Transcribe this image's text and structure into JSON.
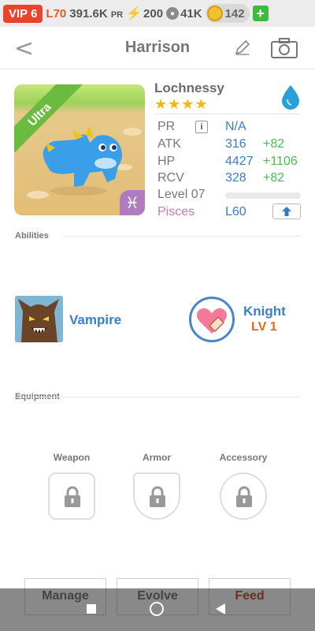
{
  "status_bar": {
    "vip": "VIP 6",
    "level": "L70",
    "power": "391.6K",
    "power_unit": "PR",
    "energy": "200",
    "food": "41K",
    "coins": "142",
    "add": "+"
  },
  "header": {
    "back_icon": "chevron-left-icon",
    "title": "Harrison",
    "edit_icon": "pencil-icon",
    "camera_icon": "camera-icon"
  },
  "pet": {
    "rarity": "Ultra",
    "zodiac_symbol": "♓",
    "name": "Lochnessy",
    "stars": "★★★★",
    "star_count": 4,
    "element_icon": "water-drop-icon",
    "colors": {
      "element": "#2aa0d8",
      "rarity": "#6abb3f",
      "zodiac": "#b07bbf"
    }
  },
  "stats": {
    "pr_label": "PR",
    "pr_info": "i",
    "pr_value": "N/A",
    "atk_label": "ATK",
    "atk_value": "316",
    "atk_bonus": "+82",
    "hp_label": "HP",
    "hp_value": "4427",
    "hp_bonus": "+1106",
    "rcv_label": "RCV",
    "rcv_value": "328",
    "rcv_bonus": "+82",
    "level_label": "Level 07",
    "level_progress": 0,
    "zodiac_label": "Pisces",
    "max_level": "L60",
    "upgrade_icon": "arrow-up-icon"
  },
  "abilities": {
    "section_label": "Abilities",
    "primary": {
      "name": "Vampire",
      "icon": "werewolf-icon"
    },
    "secondary": {
      "name": "Knight",
      "level": "LV 1",
      "icon": "heart-shield-icon"
    }
  },
  "equipment": {
    "section_label": "Equipment",
    "slots": [
      {
        "label": "Weapon",
        "icon": "lock-icon"
      },
      {
        "label": "Armor",
        "icon": "lock-icon"
      },
      {
        "label": "Accessory",
        "icon": "lock-icon"
      }
    ]
  },
  "actions": {
    "manage": "Manage",
    "evolve": "Evolve",
    "feed": "Feed"
  },
  "nav": {
    "recents_icon": "square-icon",
    "home_icon": "circle-icon",
    "back_icon": "triangle-back-icon"
  }
}
